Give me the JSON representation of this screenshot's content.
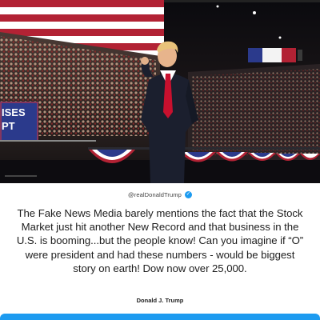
{
  "photo": {
    "sign_text_lines": [
      "ISES",
      "PT"
    ]
  },
  "post": {
    "handle": "@realDonaldTrump",
    "verified_icon": "verified-check-icon",
    "text": "The Fake News Media barely mentions the fact that the Stock Market just hit another New Record and that business in the U.S. is booming...but the people know! Can you imagine if “O” were president and had these numbers - would be biggest story on earth! Dow now over 25,000.",
    "signature": "Donald J. Trump"
  },
  "colors": {
    "accent": "#1d9bf0",
    "flag_red": "#b22234",
    "flag_blue": "#2b3a8c",
    "suit": "#1b1f2e",
    "tie": "#c8102e"
  }
}
